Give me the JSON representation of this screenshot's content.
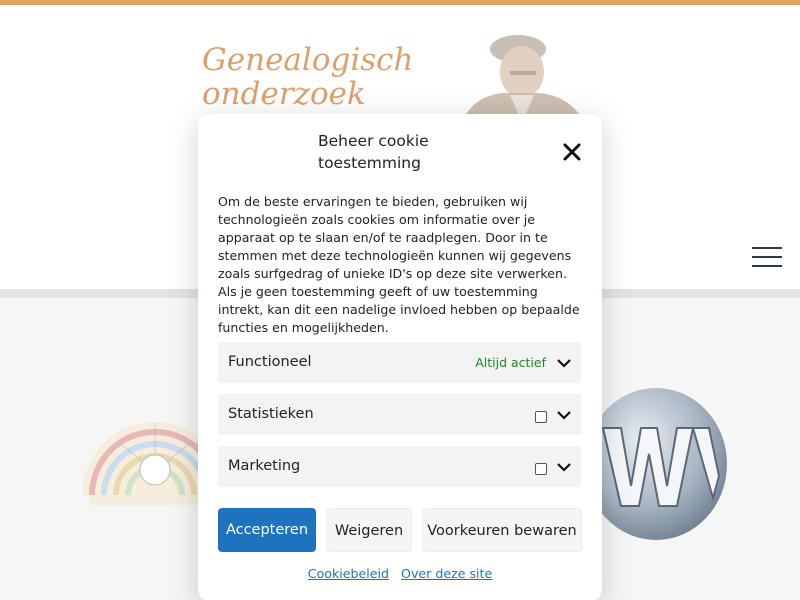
{
  "site": {
    "title_line1": "Genealogisch",
    "title_line2": "onderzoek"
  },
  "colors": {
    "accent": "#e2a06a",
    "primary_button": "#1e73be",
    "always_active": "#1e8727"
  },
  "cookie_modal": {
    "title": "Beheer cookie toestemming",
    "message": "Om de beste ervaringen te bieden, gebruiken wij technologieën zoals cookies om informatie over je apparaat op te slaan en/of te raadplegen. Door in te stemmen met deze technologieën kunnen wij gegevens zoals surfgedrag of unieke ID's op deze site verwerken. Als je geen toestemming geeft of uw toestemming intrekt, kan dit een nadelige invloed hebben op bepaalde functies en mogelijkheden.",
    "categories": [
      {
        "label": "Functioneel",
        "status": "Altijd actief",
        "checked": true
      },
      {
        "label": "Statistieken",
        "checked": false
      },
      {
        "label": "Marketing",
        "checked": false
      }
    ],
    "buttons": {
      "accept": "Accepteren",
      "deny": "Weigeren",
      "preferences": "Voorkeuren bewaren"
    },
    "links": {
      "cookie_policy": "Cookiebeleid",
      "about": "Over deze site"
    }
  },
  "icons": {
    "close": "close-icon",
    "menu": "hamburger-menu-icon",
    "expand": "chevron-down-icon"
  }
}
